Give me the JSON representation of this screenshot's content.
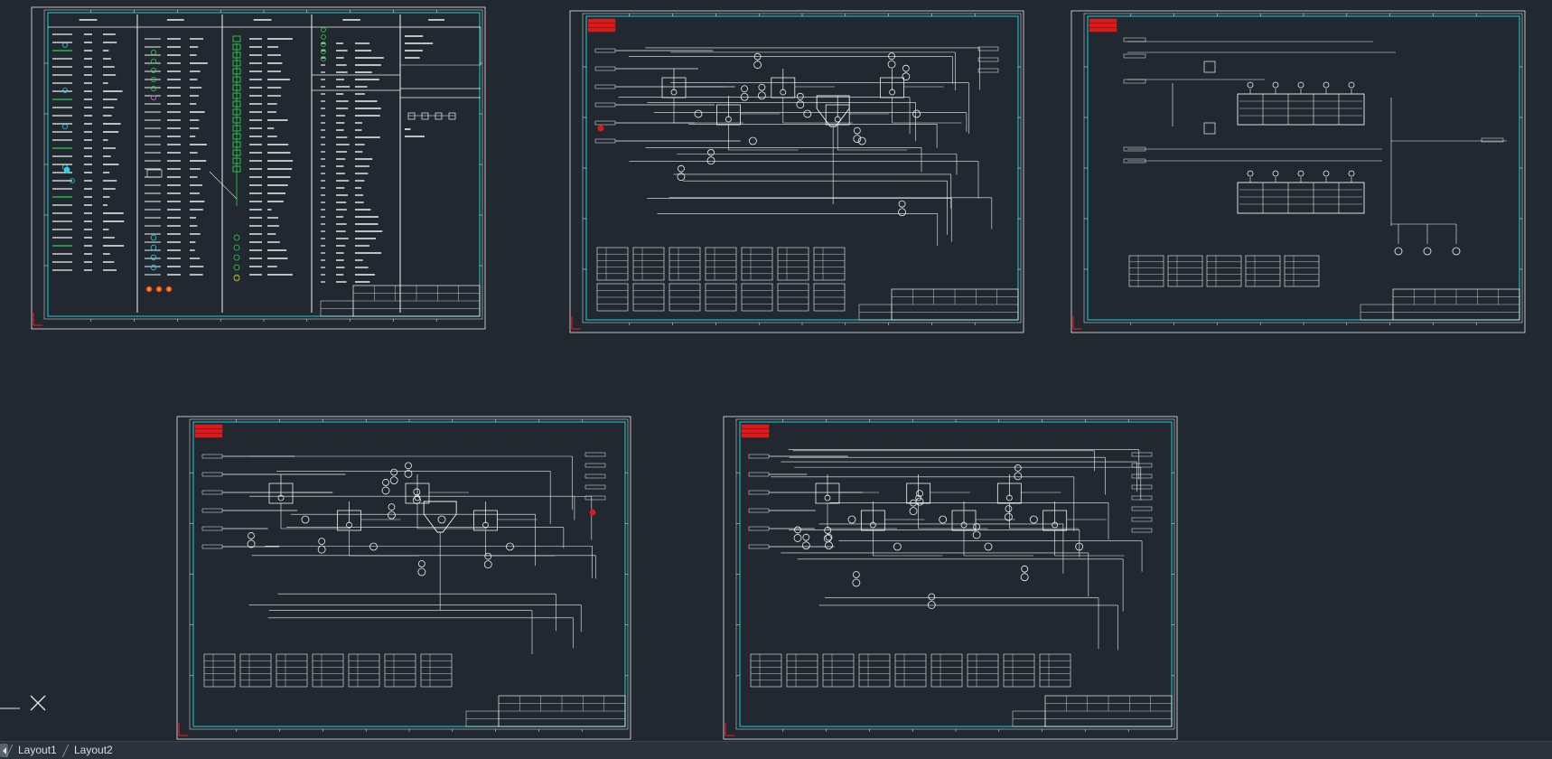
{
  "colors": {
    "background": "#212830",
    "paper_outer": "#e8e8e8",
    "paper_inner": "#19b6be",
    "linework": "#f2f2f2",
    "accent_green": "#2bd34a",
    "accent_cyan": "#27d0e8",
    "accent_red": "#e01818",
    "accent_orange": "#e88a1a"
  },
  "sheets": [
    {
      "id": "legend-sheet",
      "kind": "legend"
    },
    {
      "id": "process-flow-1",
      "kind": "process"
    },
    {
      "id": "process-flow-2",
      "kind": "tanks"
    },
    {
      "id": "process-flow-3",
      "kind": "process"
    },
    {
      "id": "process-flow-4",
      "kind": "dosing"
    }
  ],
  "ucs_icon": "ucs-axis-icon",
  "tabs": [
    {
      "label": "Layout1"
    },
    {
      "label": "Layout2"
    }
  ]
}
